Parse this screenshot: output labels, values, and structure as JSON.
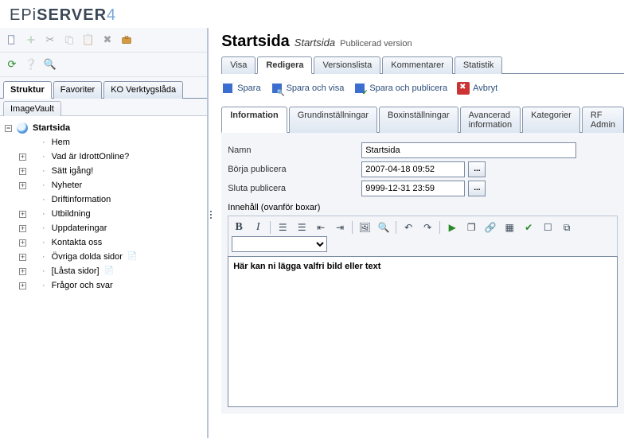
{
  "logo": {
    "prefix": "EPi",
    "main": "SERVER",
    "suffix": "4"
  },
  "header": {
    "title": "Startsida",
    "subtitle": "Startsida",
    "status": "Publicerad version"
  },
  "main_tabs": [
    {
      "id": "visa",
      "label": "Visa"
    },
    {
      "id": "redigera",
      "label": "Redigera"
    },
    {
      "id": "versionslista",
      "label": "Versionslista"
    },
    {
      "id": "kommentarer",
      "label": "Kommentarer"
    },
    {
      "id": "statistik",
      "label": "Statistik"
    }
  ],
  "main_tab_active": "redigera",
  "actions": {
    "save": "Spara",
    "save_view": "Spara och visa",
    "save_publish": "Spara och publicera",
    "cancel": "Avbryt"
  },
  "sub_tabs": [
    {
      "id": "info",
      "label": "Information"
    },
    {
      "id": "basic",
      "label": "Grundinställningar"
    },
    {
      "id": "box",
      "label": "Boxinställningar"
    },
    {
      "id": "adv",
      "label": "Avancerad information"
    },
    {
      "id": "cat",
      "label": "Kategorier"
    },
    {
      "id": "rf",
      "label": "RF Admin"
    }
  ],
  "sub_tab_active": "info",
  "form": {
    "name_label": "Namn",
    "name_value": "Startsida",
    "start_label": "Börja publicera",
    "start_value": "2007-04-18 09:52",
    "stop_label": "Sluta publicera",
    "stop_value": "9999-12-31 23:59"
  },
  "editor": {
    "label": "Innehåll (ovanför boxar)",
    "content": "Här kan ni lägga valfri bild eller text"
  },
  "left_toolbar_icons": [
    "new-page",
    "add",
    "cut",
    "copy",
    "paste",
    "delete",
    "toolbox"
  ],
  "left_toolbar_icons2": [
    "refresh",
    "help",
    "search"
  ],
  "left_tabs": [
    {
      "id": "struktur",
      "label": "Struktur"
    },
    {
      "id": "favoriter",
      "label": "Favoriter"
    },
    {
      "id": "ko",
      "label": "KO Verktygslåda"
    }
  ],
  "left_tab_active": "struktur",
  "left_tabs2": [
    {
      "id": "imagevault",
      "label": "ImageVault"
    }
  ],
  "tree": {
    "root": "Startsida",
    "items": [
      {
        "label": "Hem",
        "expandable": false
      },
      {
        "label": "Vad är IdrottOnline?",
        "expandable": true
      },
      {
        "label": "Sätt igång!",
        "expandable": true
      },
      {
        "label": "Nyheter",
        "expandable": true
      },
      {
        "label": "Driftinformation",
        "expandable": false
      },
      {
        "label": "Utbildning",
        "expandable": true
      },
      {
        "label": "Uppdateringar",
        "expandable": true
      },
      {
        "label": "Kontakta oss",
        "expandable": true
      },
      {
        "label": "Övriga dolda sidor",
        "expandable": true,
        "badge": "page"
      },
      {
        "label": "[Låsta sidor]",
        "expandable": true,
        "badge": "lock"
      },
      {
        "label": "Frågor och svar",
        "expandable": true
      }
    ]
  }
}
